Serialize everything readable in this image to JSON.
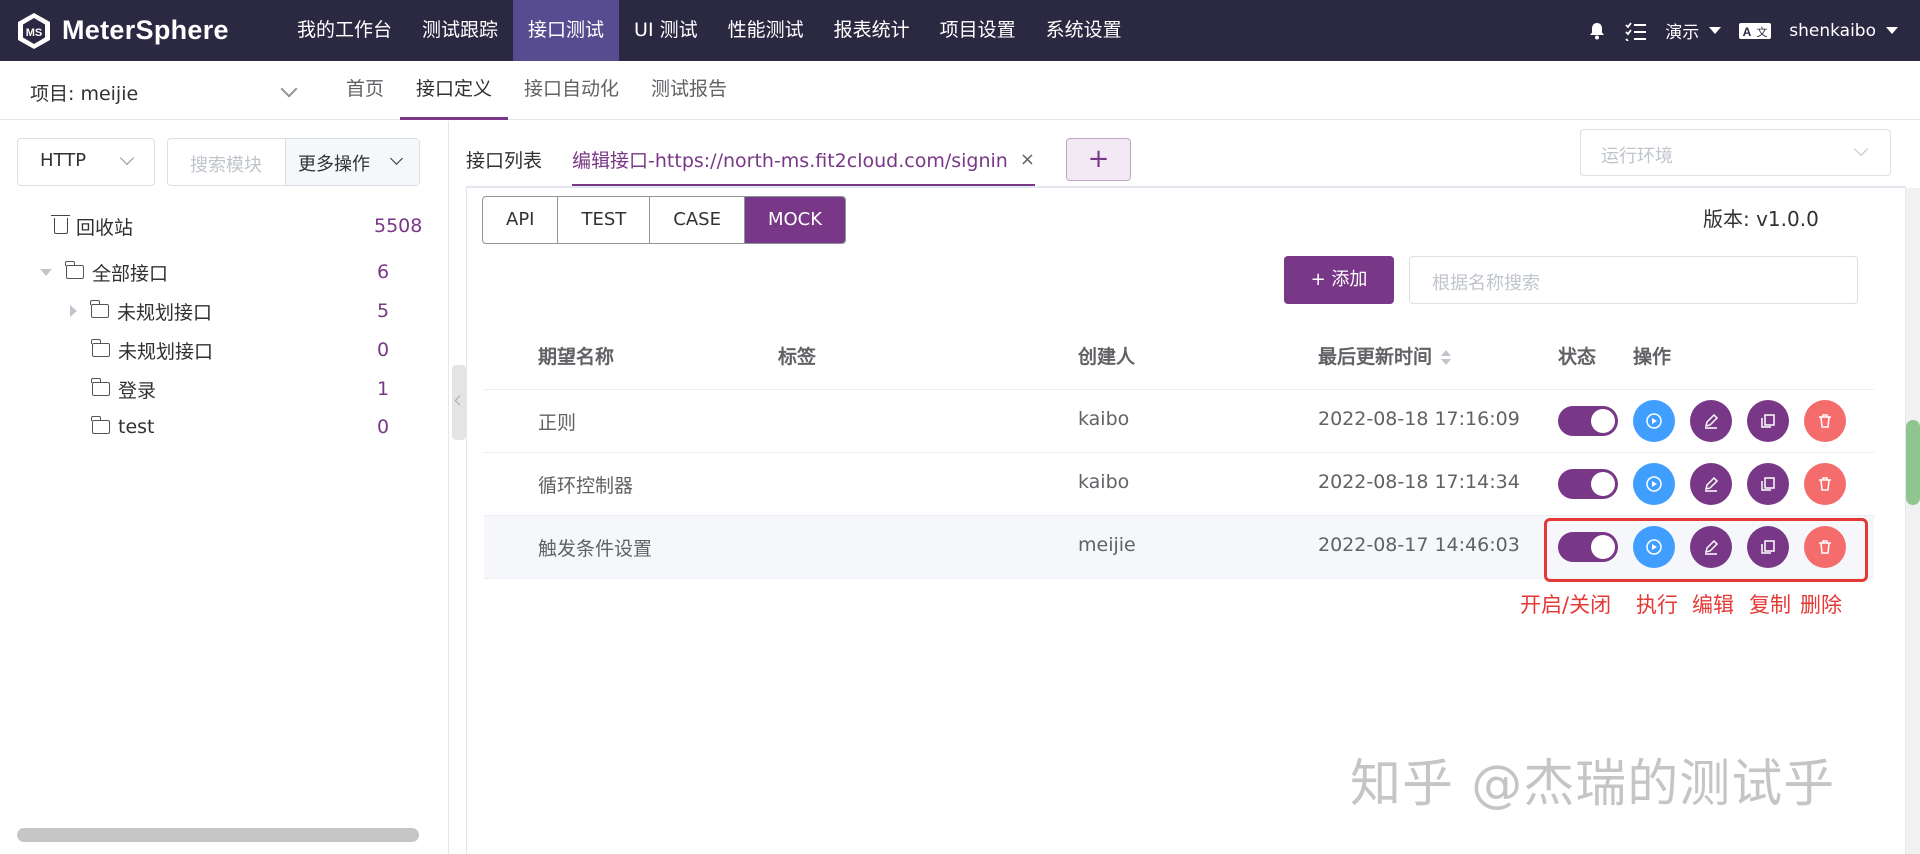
{
  "app": {
    "logo_text": "MeterSphere"
  },
  "topnav": {
    "items": [
      "我的工作台",
      "测试跟踪",
      "接口测试",
      "UI 测试",
      "性能测试",
      "报表统计",
      "项目设置",
      "系统设置"
    ],
    "workspace": "演示",
    "user": "shenkaibo"
  },
  "subnav": {
    "project_label": "项目: meijie",
    "items": [
      "首页",
      "接口定义",
      "接口自动化",
      "测试报告"
    ]
  },
  "left": {
    "protocol": "HTTP",
    "search_placeholder": "搜索模块",
    "more_ops": "更多操作",
    "tree": [
      {
        "label": "回收站",
        "count": "5508"
      },
      {
        "label": "全部接口",
        "count": "6"
      },
      {
        "label": "未规划接口",
        "count": "5"
      },
      {
        "label": "未规划接口",
        "count": "0"
      },
      {
        "label": "登录",
        "count": "1"
      },
      {
        "label": "test",
        "count": "0"
      }
    ]
  },
  "tabs": {
    "list": "接口列表",
    "edit": "编辑接口-https://north-ms.fit2cloud.com/signin",
    "close": "×",
    "add": "+",
    "env_placeholder": "运行环境"
  },
  "content": {
    "segments": [
      "API",
      "TEST",
      "CASE",
      "MOCK"
    ],
    "version": "版本: v1.0.0",
    "add_button": "+ 添加",
    "search_placeholder": "根据名称搜索",
    "columns": [
      "期望名称",
      "标签",
      "创建人",
      "最后更新时间",
      "状态",
      "操作"
    ],
    "rows": [
      {
        "name": "正则",
        "tag": "",
        "creator": "kaibo",
        "updated": "2022-08-18 17:16:09",
        "enabled": true
      },
      {
        "name": "循环控制器",
        "tag": "",
        "creator": "kaibo",
        "updated": "2022-08-18 17:14:34",
        "enabled": true
      },
      {
        "name": "触发条件设置",
        "tag": "",
        "creator": "meijie",
        "updated": "2022-08-17 14:46:03",
        "enabled": true
      }
    ],
    "annotations": [
      "开启/关闭",
      "执行",
      "编辑",
      "复制",
      "删除"
    ]
  },
  "watermark": "知乎 @杰瑞的测试乎",
  "colors": {
    "topbar": "#2b2842",
    "accent": "#783887",
    "run": "#409eff",
    "delete": "#f56c6c",
    "annotation": "#e53935"
  }
}
